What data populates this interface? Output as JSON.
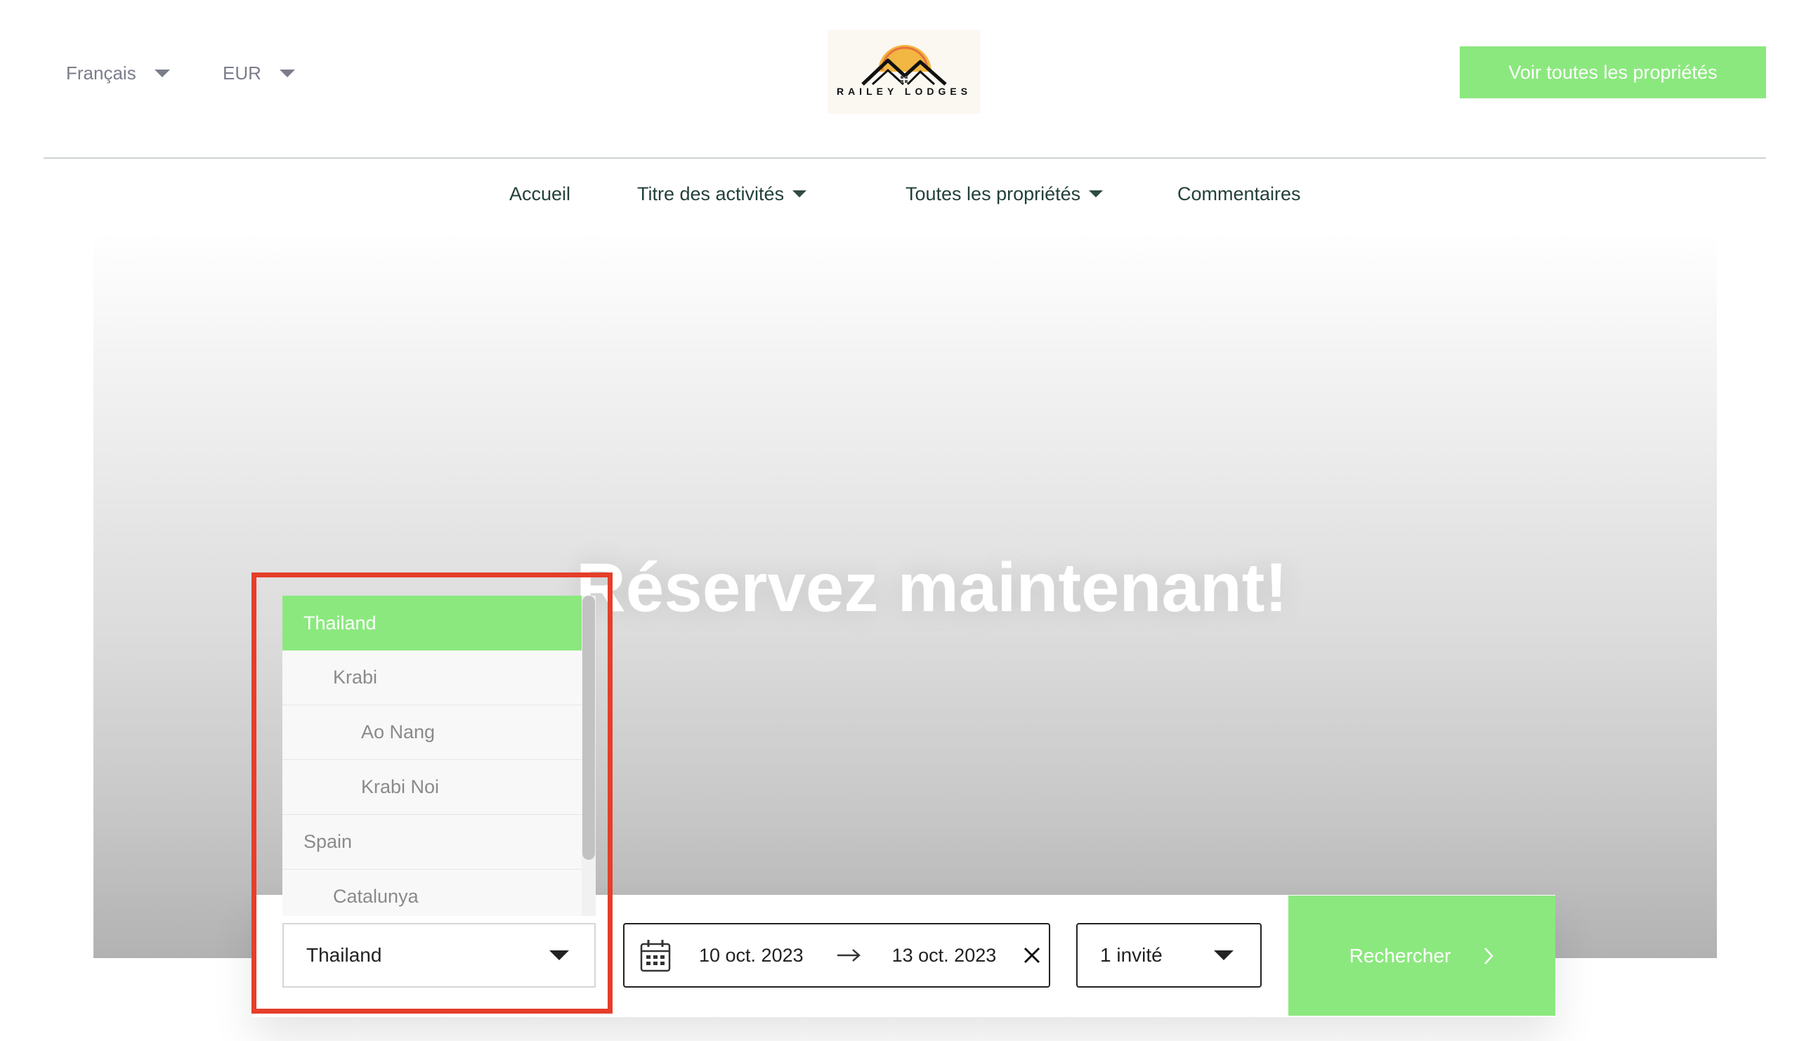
{
  "header": {
    "language_label": "Français",
    "currency_label": "EUR",
    "logo_text": "RAILEY LODGES",
    "cta_label": "Voir toutes les propriétés"
  },
  "nav": {
    "home": "Accueil",
    "activities": "Titre des activités",
    "properties": "Toutes les propriétés",
    "reviews": "Commentaires"
  },
  "hero": {
    "title": "Réservez maintenant!"
  },
  "location_dropdown": {
    "items": [
      {
        "label": "Thailand",
        "level": 0,
        "selected": true
      },
      {
        "label": "Krabi",
        "level": 1,
        "selected": false
      },
      {
        "label": "Ao Nang",
        "level": 2,
        "selected": false
      },
      {
        "label": "Krabi Noi",
        "level": 2,
        "selected": false
      },
      {
        "label": "Spain",
        "level": 0,
        "selected": false
      },
      {
        "label": "Catalunya",
        "level": 1,
        "selected": false
      }
    ],
    "selected_value": "Thailand"
  },
  "search": {
    "check_in": "10 oct. 2023",
    "check_out": "13 oct. 2023",
    "guests_label": "1 invité",
    "button_label": "Rechercher"
  },
  "colors": {
    "accent_green": "#8be87e",
    "highlight_red": "#e53e2b",
    "nav_text": "#23403a"
  }
}
